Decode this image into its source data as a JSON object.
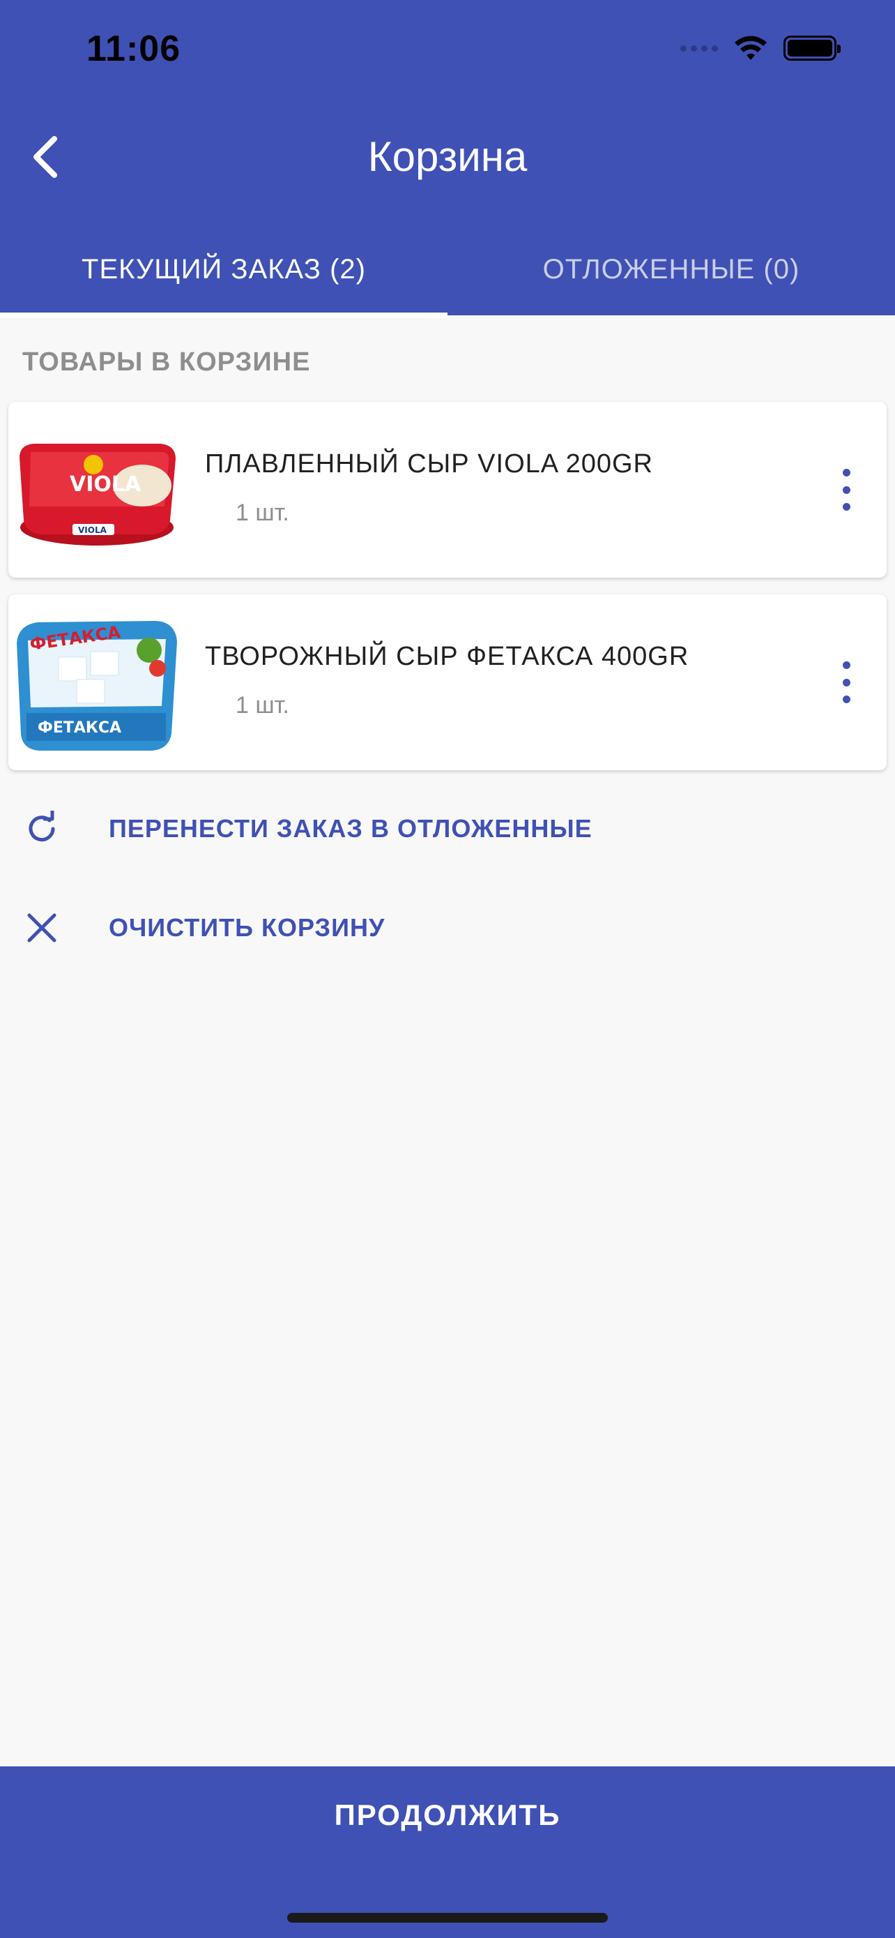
{
  "status_bar": {
    "time": "11:06"
  },
  "header": {
    "title": "Корзина"
  },
  "tabs": [
    {
      "label": "ТЕКУЩИЙ ЗАКАЗ (2)",
      "active": true
    },
    {
      "label": "ОТЛОЖЕННЫЕ (0)",
      "active": false
    }
  ],
  "section": {
    "label": "ТОВАРЫ В КОРЗИНЕ"
  },
  "items": [
    {
      "name": "ПЛАВЛЕННЫЙ СЫР VIOLA 200GR",
      "qty": "1 шт.",
      "image_brand": "VIOLA"
    },
    {
      "name": "ТВОРОЖНЫЙ СЫР ФЕТАКСА 400GR",
      "qty": "1 шт.",
      "image_brand": "ФЕТАКСА"
    }
  ],
  "actions": {
    "postpone_label": "ПЕРЕНЕСТИ ЗАКАЗ В ОТЛОЖЕННЫЕ",
    "clear_label": "ОЧИСТИТЬ КОРЗИНУ"
  },
  "footer": {
    "continue_label": "ПРОДОЛЖИТЬ"
  },
  "colors": {
    "primary": "#3f51b5",
    "background": "#f8f8f8",
    "muted_text": "#8e8e8e"
  },
  "icons": [
    "back-chevron-icon",
    "wifi-icon",
    "battery-icon",
    "more-vert-icon",
    "refresh-icon",
    "close-icon"
  ]
}
